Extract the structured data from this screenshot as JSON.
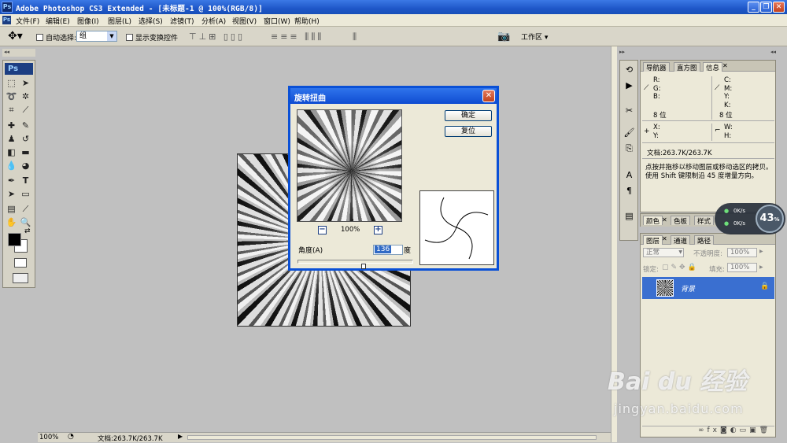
{
  "app": {
    "title": "Adobe Photoshop CS3 Extended - [未标题-1 @ 100%(RGB/8)]",
    "icon": "Ps"
  },
  "window_controls": {
    "minimize": "_",
    "restore": "❐",
    "close": "✕"
  },
  "menu": [
    "文件(F)",
    "编辑(E)",
    "图像(I)",
    "图层(L)",
    "选择(S)",
    "滤镜(T)",
    "分析(A)",
    "视图(V)",
    "窗口(W)",
    "帮助(H)"
  ],
  "options_bar": {
    "auto_select_label": "自动选择:",
    "auto_select_value": "组",
    "show_transform_label": "显示变换控件",
    "workspace_label": "工作区 ▾"
  },
  "toolbox": {
    "logo": "Ps"
  },
  "dialog": {
    "title": "旋转扭曲",
    "ok": "确定",
    "reset": "复位",
    "zoom_out": "−",
    "zoom": "100%",
    "zoom_in": "+",
    "angle_label": "角度(A)",
    "angle_value": "136",
    "angle_unit": "度",
    "angle_slider_fraction": 0.57
  },
  "info_panel": {
    "tabs": [
      "导航器",
      "直方图",
      "信息"
    ],
    "r": "R:",
    "g": "G:",
    "b": "B:",
    "c": "C:",
    "m": "M:",
    "y": "Y:",
    "k": "K:",
    "bits_left": "8 位",
    "bits_right": "8 位",
    "x": "X:",
    "y2": "Y:",
    "w": "W:",
    "h": "H:",
    "doc": "文档:263.7K/263.7K",
    "hint": "点按并拖移以移动图层或移动选区的拷贝。使用 Shift 键限制沿 45 度增量方向。"
  },
  "color_panel": {
    "tabs": [
      "颜色",
      "色板",
      "样式"
    ]
  },
  "layers_panel": {
    "tabs": [
      "图层",
      "通道",
      "路径"
    ],
    "blend_mode": "正常",
    "opacity_label": "不透明度:",
    "opacity_value": "100%",
    "lock_label": "锁定:",
    "fill_label": "填充:",
    "fill_value": "100%",
    "layer_name": "背景"
  },
  "status_bar": {
    "zoom": "100%",
    "doc": "文档:263.7K/263.7K"
  },
  "net_meter": {
    "up": "0K/s",
    "down": "0K/s",
    "percent": "43",
    "percent_unit": "%"
  },
  "watermark": {
    "brand": "Bai du 经验",
    "url": "jingyan.baidu.com"
  }
}
